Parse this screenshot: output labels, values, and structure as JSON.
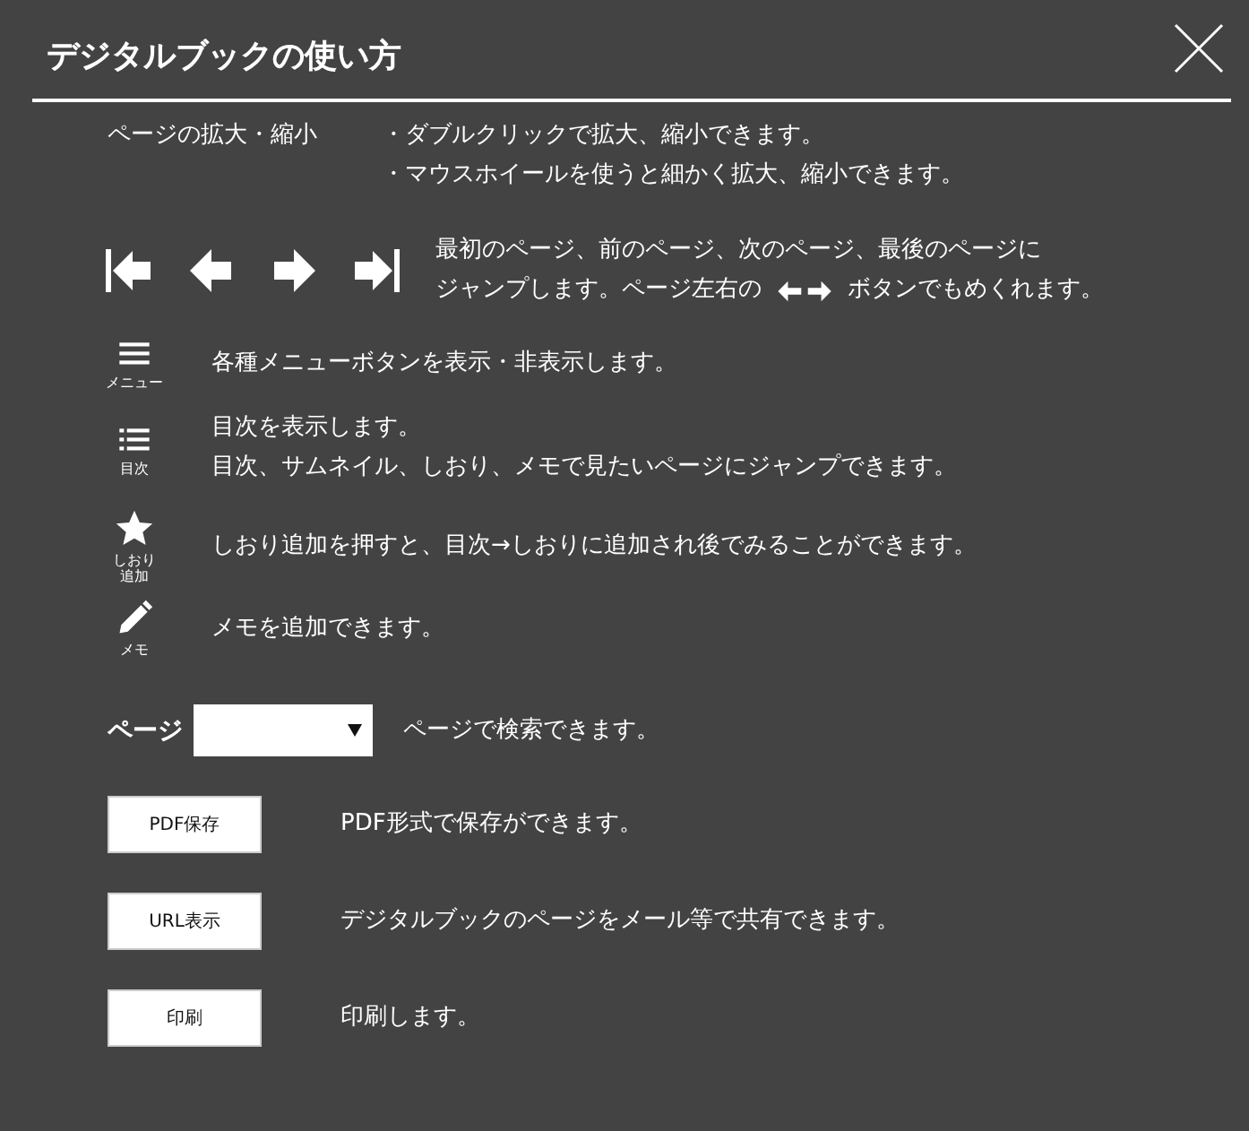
{
  "window": {
    "title": "デジタルブックの使い方"
  },
  "sections": [
    {
      "kind": "zoom",
      "label": "ページの拡大・縮小",
      "lines": [
        "・ダブルクリックで拡大、縮小できます。",
        "・マウスホイールを使うと細かく拡大、縮小できます。"
      ]
    },
    {
      "kind": "nav",
      "lines": [
        "最初のページ、前のページ、次のページ、最後のページに"
      ],
      "tail": {
        "before": "ジャンプします。ページ左右の",
        "after": "ボタンでもめくれます。"
      }
    },
    {
      "kind": "menu",
      "caption": "メニュー",
      "lines": [
        "各種メニューボタンを表示・非表示します。"
      ]
    },
    {
      "kind": "toc",
      "caption": "目次",
      "lines": [
        "目次を表示します。",
        "目次、サムネイル、しおり、メモで見たいページにジャンプできます。"
      ]
    },
    {
      "kind": "star",
      "caption": "しおり追加",
      "lines": [
        "しおり追加を押すと、目次→しおりに追加され後でみることができます。"
      ]
    },
    {
      "kind": "pen",
      "caption": "メモ",
      "lines": [
        "メモを追加できます。"
      ]
    },
    {
      "kind": "page",
      "label": "ページ",
      "lines": [
        "ページで検索できます。"
      ]
    },
    {
      "kind": "button",
      "button": "PDF保存",
      "lines": [
        "PDF形式で保存ができます。"
      ]
    },
    {
      "kind": "button",
      "button": "URL表示",
      "lines": [
        "デジタルブックのページをメール等で共有できます。"
      ]
    },
    {
      "kind": "button",
      "button": "印刷",
      "lines": [
        "印刷します。"
      ]
    }
  ]
}
